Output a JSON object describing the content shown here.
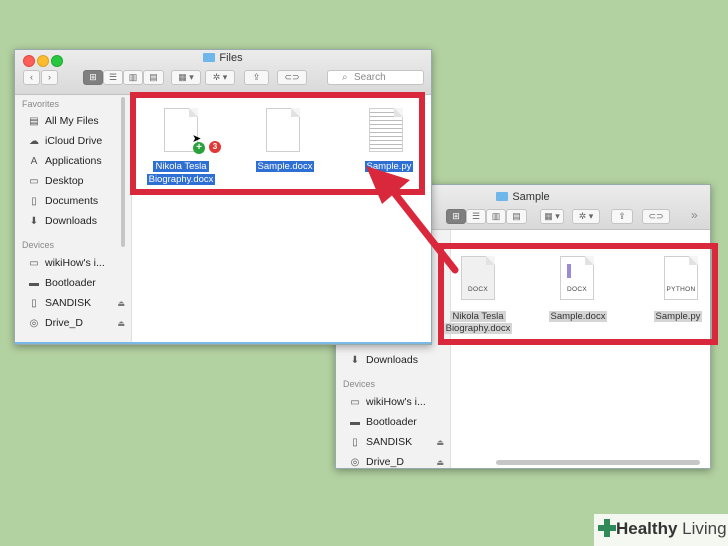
{
  "files_window": {
    "title": "Files",
    "search_placeholder": "Search",
    "sidebar": {
      "favorites_header": "Favorites",
      "favorites": [
        {
          "label": "All My Files",
          "icon": "all-files-icon"
        },
        {
          "label": "iCloud Drive",
          "icon": "cloud-icon"
        },
        {
          "label": "Applications",
          "icon": "applications-icon"
        },
        {
          "label": "Desktop",
          "icon": "desktop-icon"
        },
        {
          "label": "Documents",
          "icon": "documents-icon"
        },
        {
          "label": "Downloads",
          "icon": "downloads-icon"
        }
      ],
      "devices_header": "Devices",
      "devices": [
        {
          "label": "wikiHow's i...",
          "icon": "computer-icon"
        },
        {
          "label": "Bootloader",
          "icon": "drive-icon"
        },
        {
          "label": "SANDISK",
          "icon": "usb-drive-icon",
          "eject": "⏏"
        },
        {
          "label": "Drive_D",
          "icon": "disc-icon",
          "eject": "⏏"
        }
      ]
    },
    "files": [
      {
        "label_line1": "Nikola Tesla",
        "label_line2": "Biography.docx"
      },
      {
        "label_line1": "Sample.docx",
        "label_line2": ""
      },
      {
        "label_line1": "Sample.py",
        "label_line2": ""
      }
    ],
    "drag_badge_count": "3",
    "drag_badge_plus": "+"
  },
  "sample_window": {
    "title": "Sample",
    "overflow_chevron": "»",
    "sidebar": {
      "downloads_label": "Downloads",
      "devices_header": "Devices",
      "devices": [
        {
          "label": "wikiHow's i...",
          "icon": "computer-icon"
        },
        {
          "label": "Bootloader",
          "icon": "drive-icon"
        },
        {
          "label": "SANDISK",
          "icon": "usb-drive-icon",
          "eject": "⏏"
        },
        {
          "label": "Drive_D",
          "icon": "disc-icon",
          "eject": "⏏"
        }
      ]
    },
    "files": [
      {
        "label_line1": "Nikola Tesla",
        "label_line2": "Biography.docx",
        "ext": "DOCX"
      },
      {
        "label_line1": "Sample.docx",
        "label_line2": "",
        "ext": "DOCX"
      },
      {
        "label_line1": "Sample.py",
        "label_line2": "",
        "ext": "PYTHON"
      }
    ]
  },
  "colors": {
    "highlight": "#d9283c",
    "selection": "#2e6fd3",
    "background": "#b3d2a1"
  },
  "watermark": {
    "word1": "Healthy",
    "word2": "Living"
  }
}
